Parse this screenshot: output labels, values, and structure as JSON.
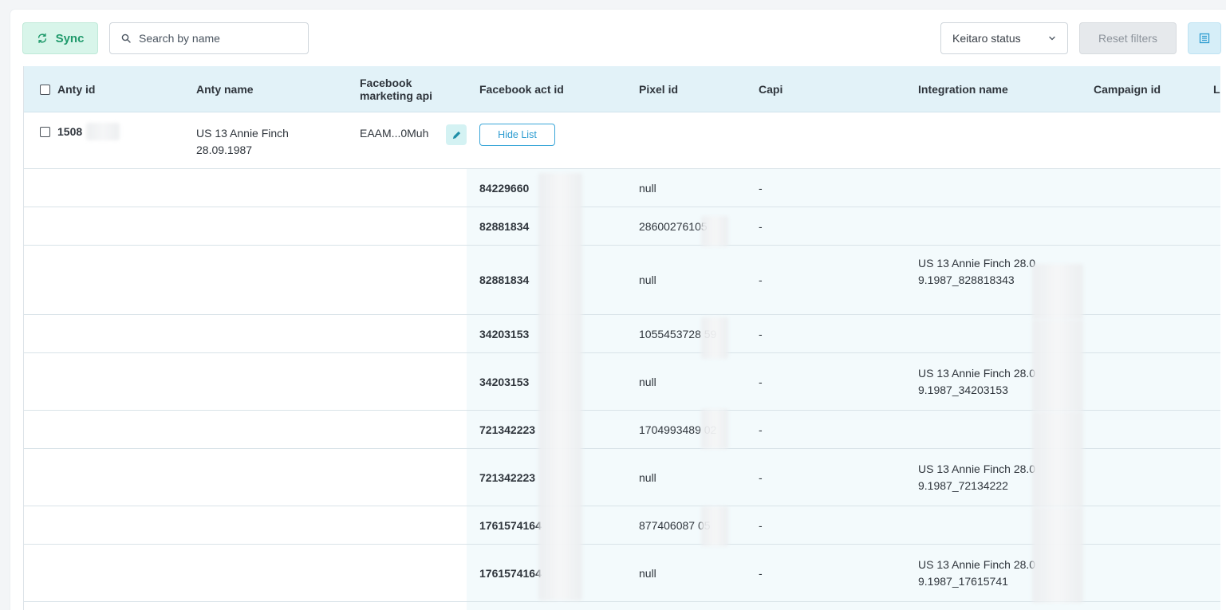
{
  "toolbar": {
    "sync_label": "Sync",
    "search_placeholder": "Search by name",
    "status_select": "Keitaro status",
    "reset_label": "Reset filters"
  },
  "table": {
    "columns": [
      "Anty id",
      "Anty name",
      "Facebook marketing api",
      "Facebook act id",
      "Pixel id",
      "Capi",
      "Integration name",
      "Campaign id",
      "L"
    ],
    "parent": {
      "anty_id": "1508",
      "anty_name": "US 13 Annie Finch 28.09.1987",
      "api_token": "EAAM...0Muh",
      "hide_list_label": "Hide List"
    },
    "rows": [
      {
        "act_id": "84229660",
        "pixel_id": "null",
        "capi": "-",
        "integration": ""
      },
      {
        "act_id": "82881834",
        "pixel_id": "28600276105",
        "capi": "-",
        "integration": ""
      },
      {
        "act_id": "82881834",
        "pixel_id": "null",
        "capi": "-",
        "integration": "US 13 Annie Finch 28.09.1987_828818343"
      },
      {
        "act_id": "34203153",
        "pixel_id": "1055453728 59",
        "capi": "-",
        "integration": ""
      },
      {
        "act_id": "34203153",
        "pixel_id": "null",
        "capi": "-",
        "integration": "US 13 Annie Finch 28.09.1987_34203153"
      },
      {
        "act_id": "721342223",
        "pixel_id": "1704993489 02",
        "capi": "-",
        "integration": ""
      },
      {
        "act_id": "721342223",
        "pixel_id": "null",
        "capi": "-",
        "integration": "US 13 Annie Finch 28.09.1987_72134222"
      },
      {
        "act_id": "1761574164",
        "pixel_id": "877406087 05",
        "capi": "-",
        "integration": ""
      },
      {
        "act_id": "1761574164",
        "pixel_id": "null",
        "capi": "-",
        "integration": "US 13 Annie Finch 28.09.1987_17615741"
      }
    ]
  },
  "colors": {
    "sync_accent": "#1f9a6b",
    "header_bg": "#e2f2f8",
    "link_blue": "#2b9bd0"
  }
}
